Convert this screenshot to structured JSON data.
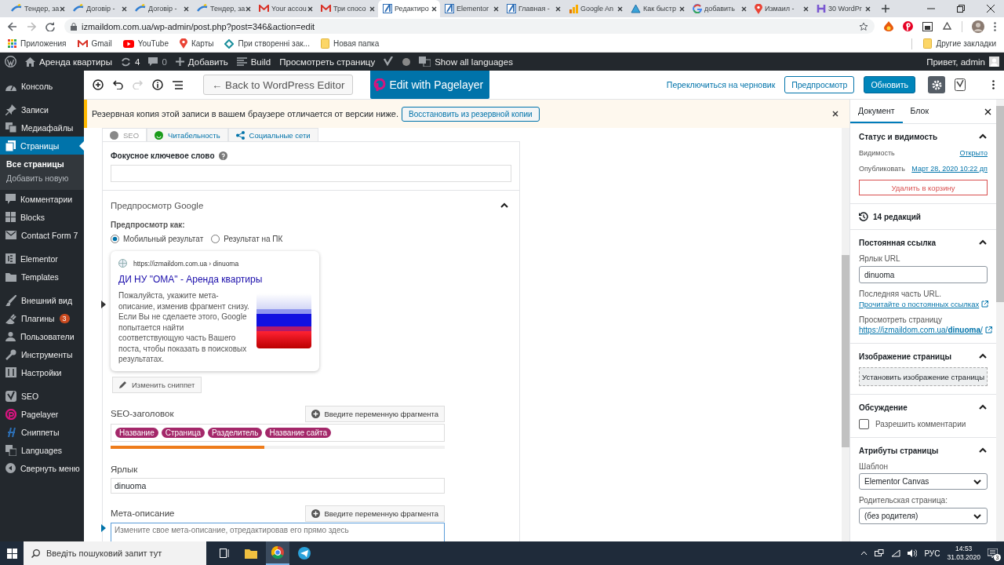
{
  "browser": {
    "tabs": [
      {
        "title": "Тендер, за",
        "kind": "pen",
        "selected": false
      },
      {
        "title": "Договір -",
        "kind": "pen",
        "selected": false
      },
      {
        "title": "Договір -",
        "kind": "pen",
        "selected": false
      },
      {
        "title": "Тендер, за",
        "kind": "pen",
        "selected": false
      },
      {
        "title": "Your accou",
        "kind": "mail",
        "selected": false
      },
      {
        "title": "Три спосо",
        "kind": "mail",
        "selected": false
      },
      {
        "title": "Редактиро",
        "kind": "square",
        "selected": true
      },
      {
        "title": "Elementor",
        "kind": "square",
        "selected": false
      },
      {
        "title": "Главная -",
        "kind": "square",
        "selected": false
      },
      {
        "title": "Google An",
        "kind": "bars",
        "selected": false
      },
      {
        "title": "Как быстр",
        "kind": "triangle",
        "selected": false
      },
      {
        "title": "добавить",
        "kind": "g",
        "selected": false
      },
      {
        "title": "Измаил -",
        "kind": "pin",
        "selected": false
      },
      {
        "title": "30 WordPr",
        "kind": "h",
        "selected": false
      }
    ],
    "url": "izmaildom.com.ua/wp-admin/post.php?post=346&action=edit",
    "bookmarks": [
      {
        "label": "Приложения",
        "kind": "apps"
      },
      {
        "label": "Gmail",
        "kind": "mail"
      },
      {
        "label": "YouTube",
        "kind": "play"
      },
      {
        "label": "Карты",
        "kind": "pin"
      },
      {
        "label": "При створенні зак...",
        "kind": "diamond"
      },
      {
        "label": "Новая папка",
        "kind": "folder"
      }
    ],
    "other_bookmarks": "Другие закладки"
  },
  "admin_bar": {
    "site": "Аренда квартиры",
    "updates": "4",
    "comments": "0",
    "new": "Добавить",
    "build": "Build",
    "view": "Просмотреть страницу",
    "languages": "Show all languages",
    "greeting": "Привет, admin"
  },
  "sidebar": {
    "groups": [
      {
        "items": [
          {
            "label": "Консоль",
            "kind": "dashboard",
            "selected": false
          }
        ]
      },
      {
        "items": [
          {
            "label": "Записи",
            "kind": "pin",
            "selected": false
          },
          {
            "label": "Медиафайлы",
            "kind": "media",
            "selected": false
          },
          {
            "label": "Страницы",
            "kind": "pages",
            "selected": true,
            "children": [
              {
                "label": "Все страницы",
                "selected": true
              },
              {
                "label": "Добавить новую",
                "selected": false
              }
            ]
          },
          {
            "label": "Комментарии",
            "kind": "comment",
            "selected": false
          },
          {
            "label": "Blocks",
            "kind": "blocks",
            "selected": false
          },
          {
            "label": "Contact Form 7",
            "kind": "mail",
            "selected": false
          }
        ]
      },
      {
        "items": [
          {
            "label": "Elementor",
            "kind": "square",
            "selected": false
          },
          {
            "label": "Templates",
            "kind": "folder",
            "selected": false
          }
        ]
      },
      {
        "items": [
          {
            "label": "Внешний вид",
            "kind": "brush",
            "selected": false
          },
          {
            "label": "Плагины",
            "kind": "plug",
            "selected": false,
            "badge": "3"
          },
          {
            "label": "Пользователи",
            "kind": "user",
            "selected": false
          },
          {
            "label": "Инструменты",
            "kind": "wrench",
            "selected": false
          },
          {
            "label": "Настройки",
            "kind": "sliders",
            "selected": false
          }
        ]
      },
      {
        "items": [
          {
            "label": "SEO",
            "kind": "y",
            "selected": false
          },
          {
            "label": "Pagelayer",
            "kind": "p",
            "selected": false
          },
          {
            "label": "Сниппеты",
            "kind": "h",
            "selected": false
          },
          {
            "label": "Languages",
            "kind": "translate",
            "selected": false
          },
          {
            "label": "Свернуть меню",
            "kind": "collapse",
            "selected": false
          }
        ]
      }
    ]
  },
  "editor": {
    "back_button": "← Back to WordPress Editor",
    "pagelayer_button": "Edit with Pagelayer",
    "draft_link": "Переключиться на черновик",
    "preview_button": "Предпросмотр",
    "update_button": "Обновить"
  },
  "notice": {
    "text": "Резервная копия этой записи в вашем браузере отличается от версии ниже.",
    "button": "Восстановить из резервной копии"
  },
  "seo": {
    "tabs": [
      {
        "label": "SEO",
        "kind": "seo",
        "selected": true
      },
      {
        "label": "Читабельность",
        "kind": "readability",
        "selected": false
      },
      {
        "label": "Социальные сети",
        "kind": "social",
        "selected": false
      }
    ],
    "focus_keyword_label": "Фокусное ключевое слово",
    "google_preview": {
      "title": "Предпросмотр Google",
      "expanded": true,
      "preview_as": "Предпросмотр как:",
      "modes": [
        {
          "label": "Мобильный результат",
          "selected": true
        },
        {
          "label": "Результат на ПК",
          "selected": false
        }
      ],
      "snippet": {
        "url": "https://izmaildom.com.ua › dinuoma",
        "title": "ДИ НУ \"ОМА\" - Аренда квартиры",
        "description": "Пожалуйста, укажите мета-описание, изменив фрагмент снизу. Если Вы не сделаете этого, Google попытается найти соответствующую часть Вашего поста, чтобы показать в поисковых результатах."
      },
      "edit_button": "Изменить сниппет"
    },
    "seo_title": {
      "label": "SEO-заголовок",
      "insert_button": "Введите переменную фрагмента",
      "chips": [
        "Название",
        "Страница",
        "Разделитель",
        "Название сайта"
      ],
      "level": 0.46
    },
    "slug": {
      "label": "Ярлык",
      "value": "dinuoma"
    },
    "meta": {
      "label": "Мета-описание",
      "insert_button": "Введите переменную фрагмента",
      "placeholder": "Измените свое мета-описание, отредактировав его прямо здесь"
    }
  },
  "panel": {
    "tabs": [
      {
        "label": "Документ",
        "selected": true
      },
      {
        "label": "Блок",
        "selected": false
      }
    ],
    "status": {
      "title": "Статус и видимость",
      "expanded": true,
      "visibility_label": "Видимость",
      "visibility": "Открыто",
      "publish_label": "Опубликовать",
      "publish": "Март 28, 2020 10:22 дп",
      "trash": "Удалить в корзину"
    },
    "revisions": "14 редакций",
    "permalink": {
      "title": "Постоянная ссылка",
      "expanded": true,
      "slug_label": "Ярлык URL",
      "slug": "dinuoma",
      "hint": "Последняя часть URL.",
      "hint_link": "Прочитайте о постоянных ссылках",
      "view_label": "Просмотреть страницу",
      "view_link": "https://izmaildom.com.ua/**dinuoma**/"
    },
    "image": {
      "title": "Изображение страницы",
      "expanded": true,
      "button": "Установить изображение страницы"
    },
    "discussion": {
      "title": "Обсуждение",
      "expanded": true,
      "allow_comments": "Разрешить комментарии",
      "checked": false
    },
    "attributes": {
      "title": "Атрибуты страницы",
      "expanded": true,
      "template_label": "Шаблон",
      "template": "Elementor Canvas",
      "parent_label": "Родительская страница:",
      "parent": "(без родителя)"
    }
  },
  "taskbar": {
    "search_placeholder": "Введіть пошуковий запит тут",
    "language": "РУС",
    "time": "14:53",
    "date": "31.03.2020",
    "notifications": "3"
  }
}
